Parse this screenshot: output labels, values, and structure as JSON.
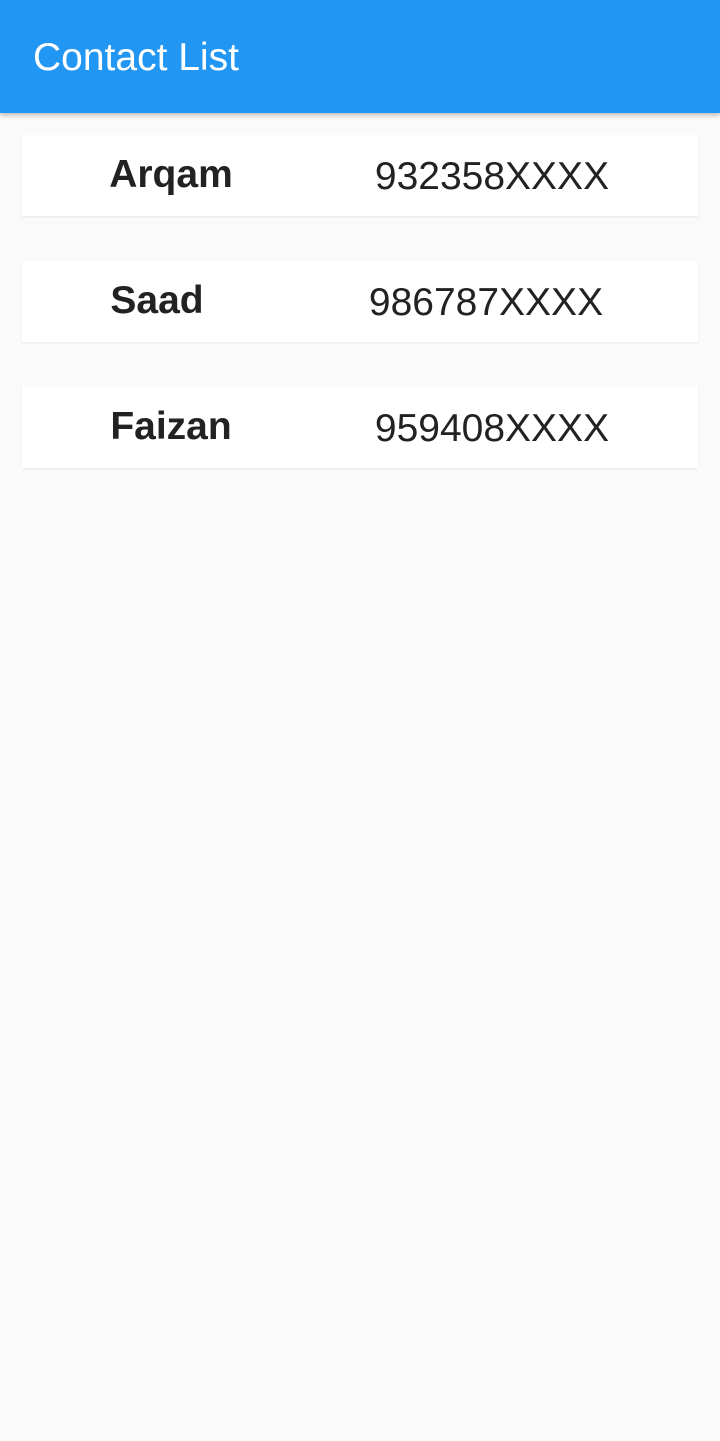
{
  "app_bar": {
    "title": "Contact List",
    "color": "#2196f3"
  },
  "contacts": [
    {
      "name": "Arqam",
      "phone": "932358XXXX"
    },
    {
      "name": "Saad",
      "phone": "986787XXXX"
    },
    {
      "name": "Faizan",
      "phone": "959408XXXX"
    }
  ]
}
